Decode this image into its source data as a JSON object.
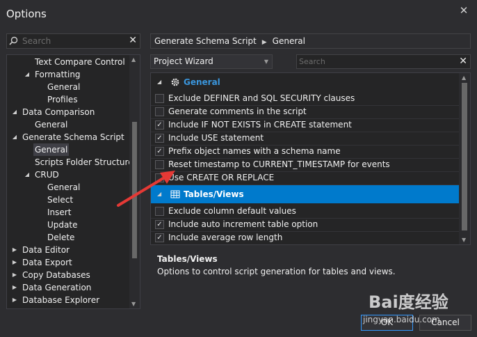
{
  "window": {
    "title": "Options"
  },
  "left_search": {
    "placeholder": "Search"
  },
  "tree": [
    {
      "label": "Text Compare Control",
      "depth": 2,
      "exp": ""
    },
    {
      "label": "Formatting",
      "depth": 2,
      "exp": "down"
    },
    {
      "label": "General",
      "depth": 3,
      "exp": ""
    },
    {
      "label": "Profiles",
      "depth": 3,
      "exp": ""
    },
    {
      "label": "Data Comparison",
      "depth": 1,
      "exp": "down"
    },
    {
      "label": "General",
      "depth": 2,
      "exp": ""
    },
    {
      "label": "Generate Schema Script",
      "depth": 1,
      "exp": "down"
    },
    {
      "label": "General",
      "depth": 2,
      "exp": "",
      "selected": true
    },
    {
      "label": "Scripts Folder Structure",
      "depth": 2,
      "exp": ""
    },
    {
      "label": "CRUD",
      "depth": 2,
      "exp": "down"
    },
    {
      "label": "General",
      "depth": 3,
      "exp": ""
    },
    {
      "label": "Select",
      "depth": 3,
      "exp": ""
    },
    {
      "label": "Insert",
      "depth": 3,
      "exp": ""
    },
    {
      "label": "Update",
      "depth": 3,
      "exp": ""
    },
    {
      "label": "Delete",
      "depth": 3,
      "exp": ""
    },
    {
      "label": "Data Editor",
      "depth": 1,
      "exp": "right"
    },
    {
      "label": "Data Export",
      "depth": 1,
      "exp": "right"
    },
    {
      "label": "Copy Databases",
      "depth": 1,
      "exp": "right"
    },
    {
      "label": "Data Generation",
      "depth": 1,
      "exp": "right"
    },
    {
      "label": "Database Explorer",
      "depth": 1,
      "exp": "right"
    }
  ],
  "breadcrumb": {
    "part1": "Generate Schema Script",
    "part2": "General"
  },
  "dropdown": {
    "value": "Project Wizard"
  },
  "right_search": {
    "placeholder": "Search"
  },
  "groups": {
    "general": "General",
    "tables": "Tables/Views"
  },
  "options_general": [
    {
      "label": "Exclude DEFINER and SQL SECURITY clauses",
      "checked": false
    },
    {
      "label": "Generate comments in the script",
      "checked": false
    },
    {
      "label": "Include IF NOT EXISTS in CREATE statement",
      "checked": true
    },
    {
      "label": "Include USE statement",
      "checked": true
    },
    {
      "label": "Prefix object names with a schema name",
      "checked": true
    },
    {
      "label": "Reset timestamp to CURRENT_TIMESTAMP for events",
      "checked": false
    },
    {
      "label": "Use CREATE OR REPLACE",
      "checked": false
    }
  ],
  "options_tables": [
    {
      "label": "Exclude column default values",
      "checked": false
    },
    {
      "label": "Include auto increment table option",
      "checked": true
    },
    {
      "label": "Include average row length",
      "checked": true
    }
  ],
  "description": {
    "title": "Tables/Views",
    "text": "Options to control script generation for tables and views."
  },
  "buttons": {
    "ok": "OK",
    "cancel": "Cancel"
  },
  "watermark": {
    "brand": "Bai度经验",
    "url": "jingyan.baidu.com"
  },
  "colors": {
    "accent": "#007acc",
    "group_text": "#3a96dd",
    "annotation": "#e53935"
  }
}
